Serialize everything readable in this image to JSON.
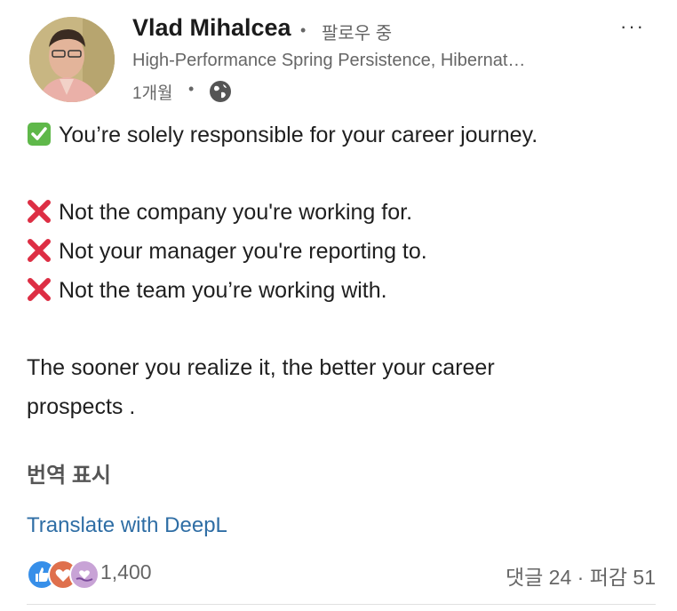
{
  "author": {
    "name": "Vlad Mihalcea",
    "separator": "•",
    "follow_status": "팔로우 중",
    "headline": "High-Performance Spring Persistence, Hibernat…",
    "posted_time": "1개월",
    "visibility_icon": "globe-icon"
  },
  "menu_label": "···",
  "post": {
    "lines": [
      {
        "icon": "check-mark-emoji",
        "text": "You’re solely responsible for your career journey."
      },
      {
        "icon": "cross-mark-emoji",
        "text": "Not the company you're working for."
      },
      {
        "icon": "cross-mark-emoji",
        "text": "Not your manager you're reporting to."
      },
      {
        "icon": "cross-mark-emoji",
        "text": "Not the team you’re working with."
      },
      {
        "icon": "",
        "text": "The sooner you realize it, the better your career"
      },
      {
        "icon": "",
        "text": "prospects ."
      }
    ]
  },
  "translation": {
    "show_translation": "번역 표시",
    "deepl": "Translate with DeepL"
  },
  "social": {
    "reaction_icons": [
      "like-icon",
      "love-icon",
      "support-icon"
    ],
    "reaction_count": "1,400",
    "comments": "댓글 24",
    "separator": "·",
    "shares": "퍼감 51"
  },
  "colors": {
    "link": "#2f6ea5",
    "check": "#5fb84a",
    "cross": "#dd2e44",
    "like": "#378fe9",
    "love": "#df704d",
    "support": "#c8a3d6"
  }
}
